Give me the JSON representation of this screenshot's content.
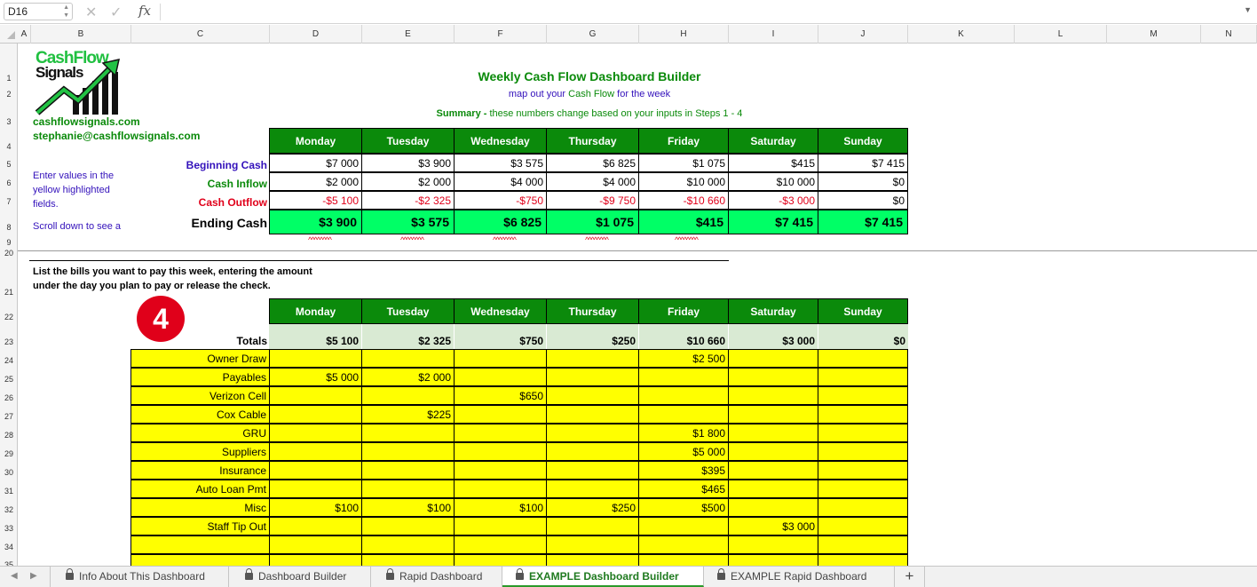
{
  "formula_bar": {
    "cell_ref": "D16",
    "fx_label": "fx",
    "formula": ""
  },
  "columns": [
    "A",
    "B",
    "C",
    "D",
    "E",
    "F",
    "G",
    "H",
    "I",
    "J",
    "K",
    "L",
    "M",
    "N"
  ],
  "rows": [
    "1",
    "2",
    "3",
    "4",
    "5",
    "6",
    "7",
    "8",
    "9",
    "20",
    "21",
    "22",
    "23",
    "24",
    "25",
    "26",
    "27",
    "28",
    "29",
    "30",
    "31",
    "32",
    "33",
    "34",
    "35"
  ],
  "logo": {
    "line1": "CashFlow",
    "line2": "Signals",
    "website": "cashflowsignals.com",
    "email": "stephanie@cashflowsignals.com"
  },
  "header": {
    "title": "Weekly Cash Flow Dashboard Builder",
    "subtitle_a": "map out your ",
    "subtitle_b": "Cash Flow",
    "subtitle_c": " for the week",
    "summary_bold": "Summary - ",
    "summary_rest": "these numbers change based on your inputs in Steps 1 - 4"
  },
  "notes": {
    "enter_line1": "Enter values in the",
    "enter_line2": "yellow highlighted",
    "enter_line3": "fields.",
    "scroll": "Scroll down to see a"
  },
  "days": [
    "Monday",
    "Tuesday",
    "Wednesday",
    "Thursday",
    "Friday",
    "Saturday",
    "Sunday"
  ],
  "summary": {
    "beginning_label": "Beginning Cash",
    "inflow_label": "Cash Inflow",
    "outflow_label": "Cash Outflow",
    "ending_label": "Ending Cash",
    "beginning": [
      "$7 000",
      "$3 900",
      "$3 575",
      "$6 825",
      "$1 075",
      "$415",
      "$7 415"
    ],
    "inflow": [
      "$2 000",
      "$2 000",
      "$4 000",
      "$4 000",
      "$10 000",
      "$10 000",
      "$0"
    ],
    "outflow": [
      "-$5 100",
      "-$2 325",
      "-$750",
      "-$9 750",
      "-$10 660",
      "-$3 000",
      "$0"
    ],
    "ending": [
      "$3 900",
      "$3 575",
      "$6 825",
      "$1 075",
      "$415",
      "$7 415",
      "$7 415"
    ],
    "carets": [
      "^^^^^^^^",
      "^^^^^^^^",
      "^^^^^^^^",
      "^^^^^^^^",
      "^^^^^^^^"
    ]
  },
  "bills_section": {
    "instruction_line1": "List the bills you want to pay this week, entering the amount",
    "instruction_line2": "under the day you plan to pay or release the check.",
    "step_number": "4",
    "totals_label": "Totals",
    "totals": [
      "$5 100",
      "$2 325",
      "$750",
      "$250",
      "$10 660",
      "$3 000",
      "$0"
    ],
    "bills": [
      {
        "name": "Owner Draw",
        "values": [
          "",
          "",
          "",
          "",
          "$2 500",
          "",
          ""
        ]
      },
      {
        "name": "Payables",
        "values": [
          "$5 000",
          "$2 000",
          "",
          "",
          "",
          "",
          ""
        ]
      },
      {
        "name": "Verizon Cell",
        "values": [
          "",
          "",
          "$650",
          "",
          "",
          "",
          ""
        ]
      },
      {
        "name": "Cox Cable",
        "values": [
          "",
          "$225",
          "",
          "",
          "",
          "",
          ""
        ]
      },
      {
        "name": "GRU",
        "values": [
          "",
          "",
          "",
          "",
          "$1 800",
          "",
          ""
        ]
      },
      {
        "name": "Suppliers",
        "values": [
          "",
          "",
          "",
          "",
          "$5 000",
          "",
          ""
        ]
      },
      {
        "name": "Insurance",
        "values": [
          "",
          "",
          "",
          "",
          "$395",
          "",
          ""
        ]
      },
      {
        "name": "Auto Loan Pmt",
        "values": [
          "",
          "",
          "",
          "",
          "$465",
          "",
          ""
        ]
      },
      {
        "name": "Misc",
        "values": [
          "$100",
          "$100",
          "$100",
          "$250",
          "$500",
          "",
          ""
        ]
      },
      {
        "name": "Staff Tip Out",
        "values": [
          "",
          "",
          "",
          "",
          "",
          "$3 000",
          ""
        ]
      },
      {
        "name": "",
        "values": [
          "",
          "",
          "",
          "",
          "",
          "",
          ""
        ]
      },
      {
        "name": "",
        "values": [
          "",
          "",
          "",
          "",
          "",
          "",
          ""
        ]
      }
    ]
  },
  "sheet_tabs": [
    {
      "label": "Info About This Dashboard",
      "active": false
    },
    {
      "label": "Dashboard Builder",
      "active": false
    },
    {
      "label": "Rapid Dashboard",
      "active": false
    },
    {
      "label": "EXAMPLE Dashboard Builder",
      "active": true
    },
    {
      "label": "EXAMPLE Rapid Dashboard",
      "active": false
    }
  ],
  "add_sheet_label": "+",
  "colors": {
    "header_green": "#0b8a0b",
    "ending_green": "#00ff66",
    "input_yellow": "#ffff00",
    "totals_green": "#d9ead3",
    "step_badge_red": "#e0001a"
  }
}
